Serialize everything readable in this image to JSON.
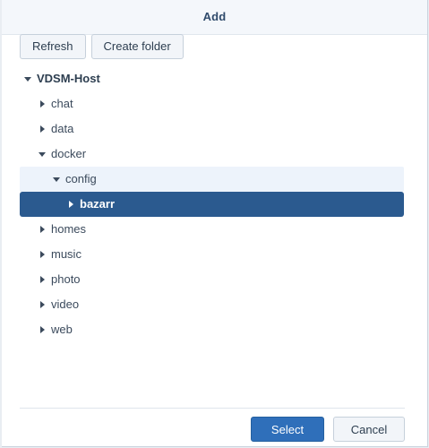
{
  "dialog": {
    "title": "Add"
  },
  "toolbar": {
    "refresh_label": "Refresh",
    "create_folder_label": "Create folder"
  },
  "tree": {
    "root": {
      "label": "VDSM-Host",
      "expanded": true
    },
    "shares": [
      {
        "label": "chat",
        "expanded": false
      },
      {
        "label": "data",
        "expanded": false
      },
      {
        "label": "docker",
        "expanded": true
      },
      {
        "label": "homes",
        "expanded": false
      },
      {
        "label": "music",
        "expanded": false
      },
      {
        "label": "photo",
        "expanded": false
      },
      {
        "label": "video",
        "expanded": false
      },
      {
        "label": "web",
        "expanded": false
      }
    ],
    "docker_children": [
      {
        "label": "config",
        "expanded": true
      }
    ],
    "config_children": [
      {
        "label": "bazarr",
        "expanded": false,
        "selected": true
      }
    ]
  },
  "footer": {
    "select_label": "Select",
    "cancel_label": "Cancel"
  },
  "colors": {
    "selected_row": "#2b5a8f",
    "hover_row": "#edf3fb",
    "primary_button": "#2f6fba",
    "title_text": "#2f4a6b"
  },
  "icons": {
    "expanded": "caret-down-icon",
    "collapsed": "caret-right-icon"
  }
}
